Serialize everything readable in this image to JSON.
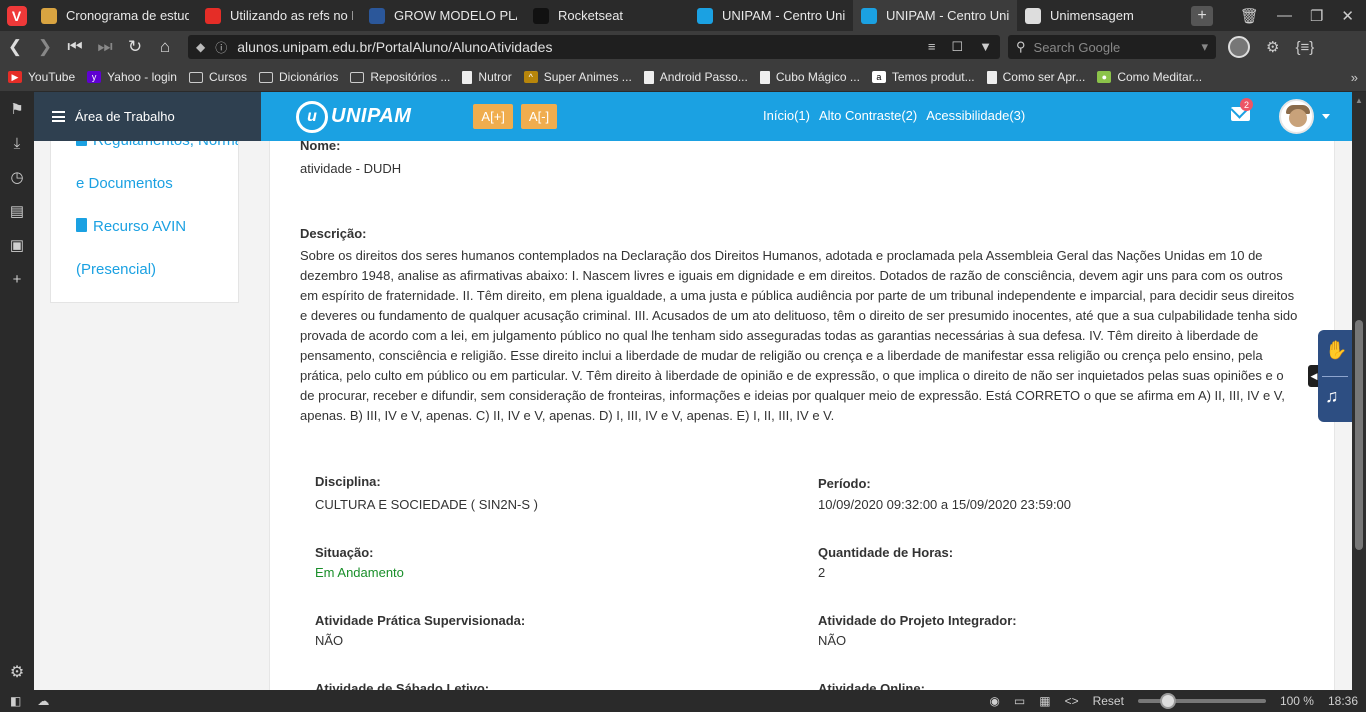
{
  "browser": {
    "tabs": [
      {
        "title": "Cronograma de estudos",
        "color": "#d9a441",
        "active": false
      },
      {
        "title": "Utilizando as refs no Re",
        "color": "#e52d27",
        "active": false
      },
      {
        "title": "GROW MODELO PLANE",
        "color": "#2b579a",
        "active": false
      },
      {
        "title": "Rocketseat",
        "color": "#111111",
        "active": false
      },
      {
        "title": "UNIPAM - Centro Univer",
        "color": "#1ba1e2",
        "active": false
      },
      {
        "title": "UNIPAM - Centro Univer",
        "color": "#1ba1e2",
        "active": true
      },
      {
        "title": "Unimensagem",
        "color": "#dddddd",
        "active": false
      }
    ],
    "url": "alunos.unipam.edu.br/PortalAluno/AlunoAtividades",
    "search_placeholder": "Search Google",
    "bookmarks": [
      {
        "label": "YouTube",
        "kind": "yt"
      },
      {
        "label": "Yahoo - login",
        "kind": "yahoo"
      },
      {
        "label": "Cursos",
        "kind": "folder"
      },
      {
        "label": "Dicionários",
        "kind": "folder"
      },
      {
        "label": "Repositórios ...",
        "kind": "folder"
      },
      {
        "label": "Nutror",
        "kind": "doc"
      },
      {
        "label": "Super Animes ...",
        "kind": "anime"
      },
      {
        "label": "Android Passo...",
        "kind": "doc"
      },
      {
        "label": "Cubo Mágico ...",
        "kind": "doc"
      },
      {
        "label": "Temos produt...",
        "kind": "amazon"
      },
      {
        "label": "Como ser Apr...",
        "kind": "doc"
      },
      {
        "label": "Como Meditar...",
        "kind": "meditar"
      }
    ],
    "status": {
      "reset_label": "Reset",
      "zoom": "100 %",
      "zoom_fraction": 0.2,
      "clock": "18:36"
    }
  },
  "app": {
    "menu_title": "Área de Trabalho",
    "brand": "UNIPAM",
    "font_increase": "A[+]",
    "font_decrease": "A[-]",
    "nav": {
      "inicio": "Início(1)",
      "alto_contraste": "Alto Contraste(2)",
      "acessibilidade": "Acessibilidade(3)"
    },
    "mail_badge": "2",
    "sidebar_links": {
      "regulamentos_line1": "Regulamentos, Normas",
      "regulamentos_line2": "e Documentos",
      "recurso_line1": "Recurso AVIN",
      "recurso_line2": "(Presencial)"
    }
  },
  "activity": {
    "nome_label": "Nome:",
    "nome_value": "atividade - DUDH",
    "descricao_label": "Descrição:",
    "descricao_value": "Sobre os direitos dos seres humanos contemplados na Declaração dos Direitos Humanos, adotada e proclamada pela Assembleia Geral das Nações Unidas em 10 de dezembro 1948, analise as afirmativas abaixo: I. Nascem livres e iguais em dignidade e em direitos. Dotados de razão de consciência, devem agir uns para com os outros em espírito de fraternidade. II. Têm direito, em plena igualdade, a uma justa e pública audiência por parte de um tribunal independente e imparcial, para decidir seus direitos e deveres ou fundamento de qualquer acusação criminal. III. Acusados de um ato delituoso, têm o direito de ser presumido inocentes, até que a sua culpabilidade tenha sido provada de acordo com a lei, em julgamento público no qual lhe tenham sido asseguradas todas as garantias necessárias à sua defesa. IV. Têm direito à liberdade de pensamento, consciência e religião. Esse direito inclui a liberdade de mudar de religião ou crença e a liberdade de manifestar essa religião ou crença pelo ensino, pela prática, pelo culto em público ou em particular. V. Têm direito à liberdade de opinião e de expressão, o que implica o direito de não ser inquietados pelas suas opiniões e o de procurar, receber e difundir, sem consideração de fronteiras, informações e ideias por qualquer meio de expressão. Está CORRETO o que se afirma em A) II, III, IV e V, apenas. B) III, IV e V, apenas. C) II, IV e V, apenas. D) I, III, IV e V, apenas. E) I, II, III, IV e V.",
    "disciplina_label": "Disciplina:",
    "disciplina_value": "CULTURA E SOCIEDADE ( SIN2N-S )",
    "periodo_label": "Período:",
    "periodo_value": "10/09/2020 09:32:00 a 15/09/2020 23:59:00",
    "situacao_label": "Situação:",
    "situacao_value": "Em Andamento",
    "horas_label": "Quantidade de Horas:",
    "horas_value": "2",
    "aps_label": "Atividade Prática Supervisionada:",
    "aps_value": "NÃO",
    "projeto_label": "Atividade do Projeto Integrador:",
    "projeto_value": "NÃO",
    "sabado_label": "Atividade de Sábado Letivo:",
    "online_label": "Atividade Online:"
  }
}
